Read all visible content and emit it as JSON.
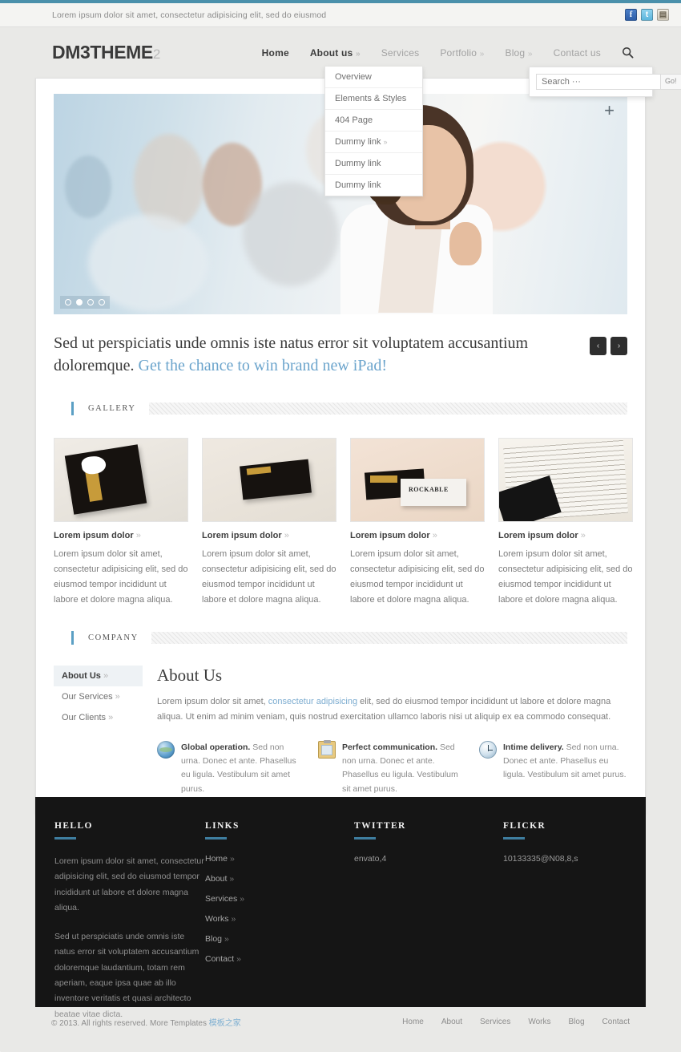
{
  "topbar": {
    "tagline": "Lorem ipsum dolor sit amet, consectetur adipisicing elit, sed do eiusmod",
    "social": [
      {
        "name": "facebook-icon",
        "glyph": "f"
      },
      {
        "name": "twitter-icon",
        "glyph": "t"
      },
      {
        "name": "rss-icon",
        "glyph": "▤"
      }
    ]
  },
  "header": {
    "logo_main": "DM3THEME",
    "logo_sub": "2",
    "nav": [
      {
        "label": "Home",
        "caret": "",
        "active": true
      },
      {
        "label": "About us",
        "caret": "»",
        "active": true
      },
      {
        "label": "Services",
        "caret": "",
        "active": false
      },
      {
        "label": "Portfolio",
        "caret": "»",
        "active": false
      },
      {
        "label": "Blog",
        "caret": "»",
        "active": false
      },
      {
        "label": "Contact us",
        "caret": "",
        "active": false
      }
    ],
    "search_icon": "search-icon"
  },
  "dropdown": {
    "items": [
      {
        "label": "Overview",
        "caret": ""
      },
      {
        "label": "Elements & Styles",
        "caret": ""
      },
      {
        "label": "404 Page",
        "caret": ""
      },
      {
        "label": "Dummy link",
        "caret": "»"
      },
      {
        "label": "Dummy link",
        "caret": ""
      },
      {
        "label": "Dummy link",
        "caret": ""
      }
    ]
  },
  "search": {
    "value": "",
    "placeholder": "Search ···",
    "button": "Go!"
  },
  "hero": {
    "plus_icon": "expand-plus-icon",
    "dots": [
      {
        "active": false
      },
      {
        "active": true
      },
      {
        "active": false
      },
      {
        "active": false
      }
    ],
    "caption_plain": "Sed ut perspiciatis unde omnis iste natus error sit voluptatem accusantium doloremque.",
    "caption_link": "Get the chance to win brand new iPad!",
    "prev": "‹",
    "next": "›"
  },
  "gallery": {
    "section_title": "GALLERY",
    "items": [
      {
        "title": "Lorem ipsum dolor",
        "caret": "»",
        "desc": "Lorem ipsum dolor sit amet, consectetur adipisicing elit, sed do eiusmod tempor incididunt ut labore et dolore magna aliqua."
      },
      {
        "title": "Lorem ipsum dolor",
        "caret": "»",
        "desc": "Lorem ipsum dolor sit amet, consectetur adipisicing elit, sed do eiusmod tempor incididunt ut labore et dolore magna aliqua."
      },
      {
        "title": "Lorem ipsum dolor",
        "caret": "»",
        "desc": "Lorem ipsum dolor sit amet, consectetur adipisicing elit, sed do eiusmod tempor incididunt ut labore et dolore magna aliqua."
      },
      {
        "title": "Lorem ipsum dolor",
        "caret": "»",
        "desc": "Lorem ipsum dolor sit amet, consectetur adipisicing elit, sed do eiusmod tempor incididunt ut labore et dolore magna aliqua."
      }
    ]
  },
  "company": {
    "section_title": "COMPANY",
    "side_nav": [
      {
        "label": "About Us",
        "caret": "»",
        "active": true
      },
      {
        "label": "Our Services",
        "caret": "»",
        "active": false
      },
      {
        "label": "Our Clients",
        "caret": "»",
        "active": false
      }
    ],
    "heading": "About Us",
    "body_pre": "Lorem ipsum dolor sit amet, ",
    "body_link": "consectetur adipisicing",
    "body_post": " elit, sed do eiusmod tempor incididunt ut labore et dolore magna aliqua. Ut enim ad minim veniam, quis nostrud exercitation ullamco laboris nisi ut aliquip ex ea commodo consequat.",
    "features": [
      {
        "icon": "globe-icon",
        "title": "Global operation.",
        "text": " Sed non urna. Donec et ante. Phasellus eu ligula. Vestibulum sit amet purus."
      },
      {
        "icon": "clipboard-icon",
        "title": "Perfect communication.",
        "text": " Sed non urna. Donec et ante. Phasellus eu ligula. Vestibulum sit amet purus."
      },
      {
        "icon": "clock-icon",
        "title": "Intime delivery.",
        "text": " Sed non urna. Donec et ante. Phasellus eu ligula. Vestibulum sit amet purus."
      }
    ]
  },
  "footer": {
    "hello": {
      "heading": "HELLO",
      "p1": "Lorem ipsum dolor sit amet, consectetur adipisicing elit, sed do eiusmod tempor incididunt ut labore et dolore magna aliqua.",
      "p2": "Sed ut perspiciatis unde omnis iste natus error sit voluptatem accusantium doloremque laudantium, totam rem aperiam, eaque ipsa quae ab illo inventore veritatis et quasi architecto beatae vitae dicta."
    },
    "links": {
      "heading": "LINKS",
      "items": [
        {
          "label": "Home",
          "caret": "»"
        },
        {
          "label": "About",
          "caret": "»"
        },
        {
          "label": "Services",
          "caret": "»"
        },
        {
          "label": "Works",
          "caret": "»"
        },
        {
          "label": "Blog",
          "caret": "»"
        },
        {
          "label": "Contact",
          "caret": "»"
        }
      ]
    },
    "twitter": {
      "heading": "TWITTER",
      "entry": "envato,4"
    },
    "flickr": {
      "heading": "FLICKR",
      "entry": "10133335@N08,8,s"
    }
  },
  "bottombar": {
    "copyright_pre": "© 2013. All rights reserved. More Templates ",
    "copyright_link": "模板之家",
    "nav": [
      "Home",
      "About",
      "Services",
      "Works",
      "Blog",
      "Contact"
    ]
  },
  "colors": {
    "accent": "#4a90ab",
    "link": "#6ba4cc",
    "footer_bg": "#151515",
    "page_bg": "#e9e9e7"
  }
}
